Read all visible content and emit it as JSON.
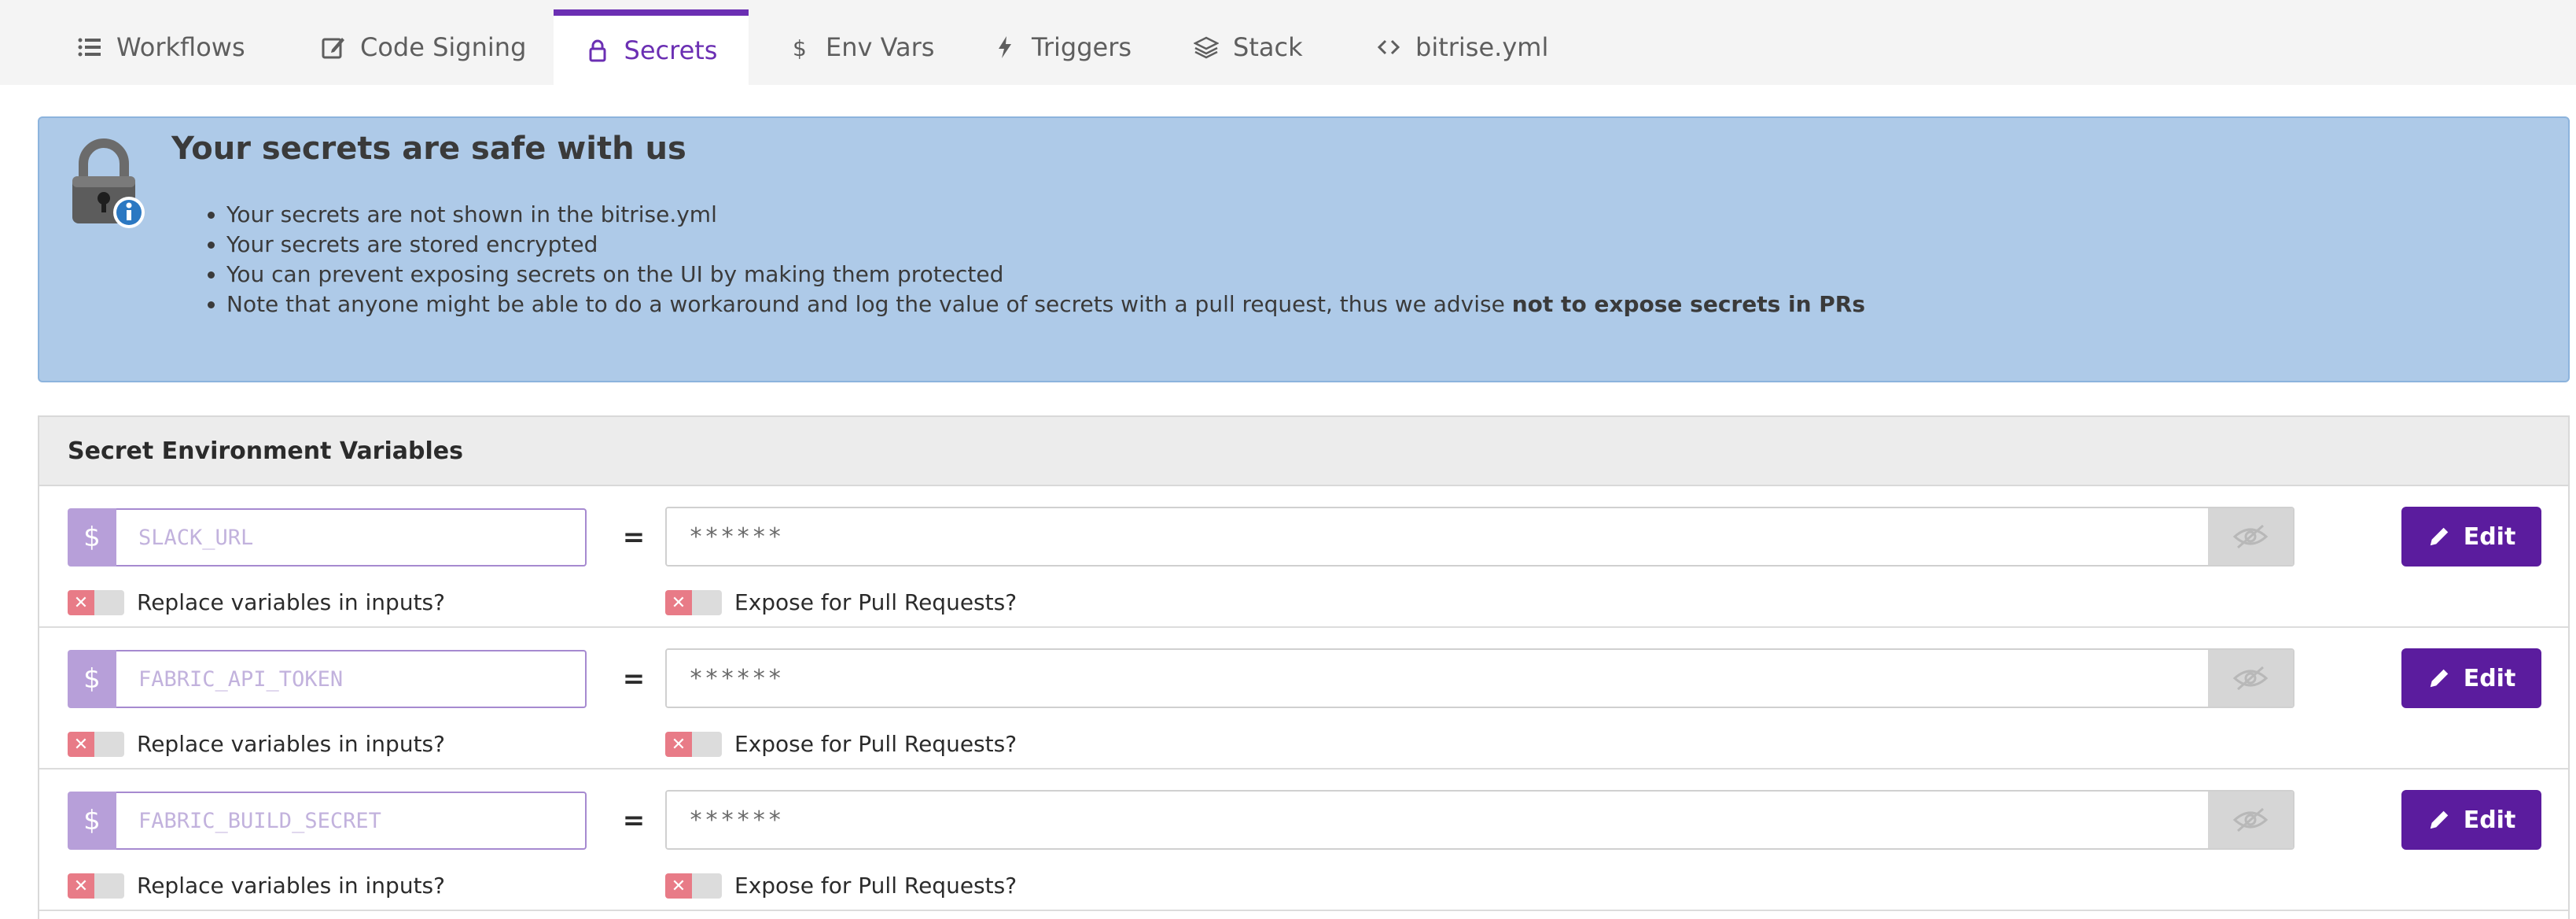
{
  "tabs": [
    {
      "label": "Workflows",
      "icon": "list-icon"
    },
    {
      "label": "Code Signing",
      "icon": "edit-box-icon"
    },
    {
      "label": "Secrets",
      "icon": "lock-icon",
      "active": true
    },
    {
      "label": "Env Vars",
      "icon": "dollar-icon"
    },
    {
      "label": "Triggers",
      "icon": "bolt-icon"
    },
    {
      "label": "Stack",
      "icon": "layers-icon"
    },
    {
      "label": "bitrise.yml",
      "icon": "code-icon"
    }
  ],
  "notice": {
    "title": "Your secrets are safe with us",
    "items": [
      "Your secrets are not shown in the bitrise.yml",
      "Your secrets are stored encrypted",
      "You can prevent exposing secrets on the UI by making them protected"
    ],
    "last_item_prefix": "Note that anyone might be able to do a workaround and log the value of secrets with a pull request, thus we advise ",
    "last_item_bold": "not to expose secrets in PRs"
  },
  "panel": {
    "title": "Secret Environment Variables",
    "equals": "=",
    "dollar": "$",
    "edit_label": "Edit",
    "replace_label": "Replace variables in inputs?",
    "expose_label": "Expose for Pull Requests?",
    "rows": [
      {
        "key": "SLACK_URL",
        "value": "******",
        "replace_enabled": false,
        "expose_enabled": false
      },
      {
        "key": "FABRIC_API_TOKEN",
        "value": "******",
        "replace_enabled": false,
        "expose_enabled": false
      },
      {
        "key": "FABRIC_BUILD_SECRET",
        "value": "******",
        "replace_enabled": false,
        "expose_enabled": false
      }
    ]
  },
  "colors": {
    "accent": "#6b2fb3",
    "edit_button": "#5b1c9e",
    "notice_bg": "#aecae8",
    "toggle_off_x": "#e87b87"
  }
}
